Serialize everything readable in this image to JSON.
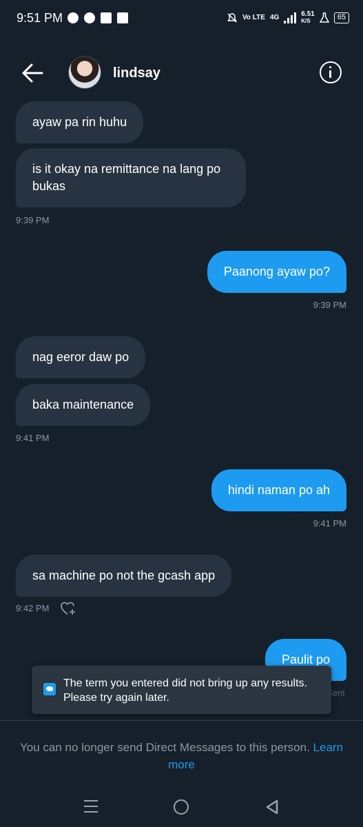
{
  "status_bar": {
    "time": "9:51 PM",
    "network": "Vo LTE",
    "signal_type": "4G",
    "speed": "6.51",
    "speed_unit": "K/S",
    "battery": "65"
  },
  "header": {
    "contact_name": "lindsay",
    "back_icon": "arrow-left-icon",
    "info_icon": "info-icon"
  },
  "messages": [
    {
      "direction": "in",
      "text": "ayaw pa rin huhu"
    },
    {
      "direction": "in",
      "text": "is it okay na remittance na lang po bukas",
      "timestamp": "9:39 PM"
    },
    {
      "direction": "out",
      "text": "Paanong ayaw po?",
      "timestamp": "9:39 PM"
    },
    {
      "direction": "in",
      "text": "nag eeror daw po"
    },
    {
      "direction": "in",
      "text": "baka maintenance",
      "timestamp": "9:41 PM"
    },
    {
      "direction": "out",
      "text": "hindi naman po ah",
      "timestamp": "9:41 PM"
    },
    {
      "direction": "in",
      "text": "sa machine po not the gcash app",
      "timestamp": "9:42 PM"
    },
    {
      "direction": "out",
      "text": "Paulit po",
      "timestamp": "9:46 PM · Sent"
    }
  ],
  "toast": {
    "text": "The term you entered did not bring up any results. Please try again later."
  },
  "notice": {
    "text": "You can no longer send Direct Messages to this person. ",
    "link": "Learn more"
  },
  "colors": {
    "background": "#15202b",
    "incoming_bubble": "#273340",
    "outgoing_bubble": "#1d9bf0",
    "timestamp": "#8b98a5"
  }
}
